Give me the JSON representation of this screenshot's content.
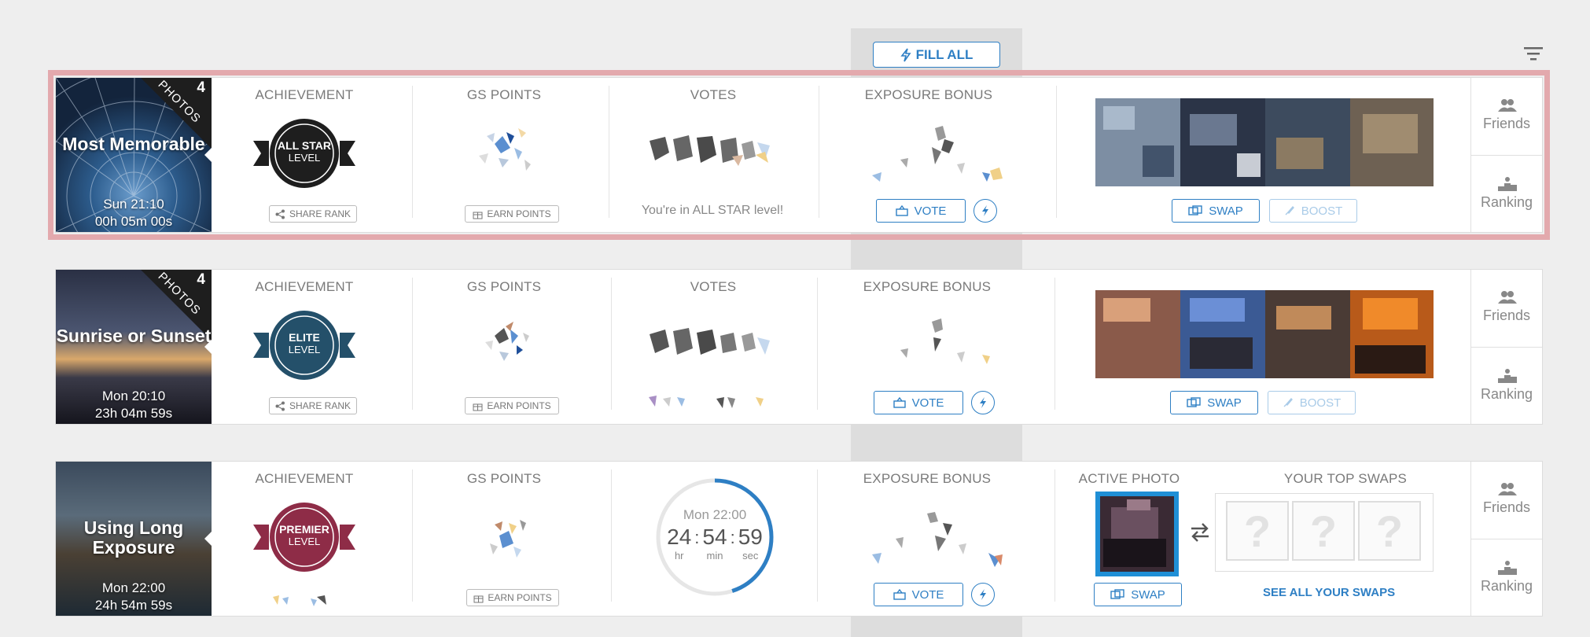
{
  "fill_all_label": "FILL ALL",
  "sections": {
    "achievement": "ACHIEVEMENT",
    "gs_points": "GS POINTS",
    "votes": "VOTES",
    "exposure_bonus": "EXPOSURE BONUS",
    "active_photo": "ACTIVE PHOTO",
    "your_top_swaps": "YOUR TOP SWAPS"
  },
  "buttons": {
    "share_rank": "SHARE RANK",
    "earn_points": "EARN POINTS",
    "vote": "VOTE",
    "swap": "SWAP",
    "boost": "BOOST",
    "see_all_swaps": "SEE ALL YOUR SWAPS"
  },
  "side": {
    "friends": "Friends",
    "ranking": "Ranking"
  },
  "challenges": [
    {
      "photos_label": "PHOTOS",
      "photos_count": "4",
      "title": "Most Memorable",
      "date": "Sun 21:10",
      "countdown": "00h 05m 00s",
      "level_line1": "ALL STAR",
      "level_line2": "LEVEL",
      "level_color": "#1e1e1e",
      "votes_note": "You're in ALL STAR level!"
    },
    {
      "photos_label": "PHOTOS",
      "photos_count": "4",
      "title": "Sunrise or Sunset",
      "date": "Mon 20:10",
      "countdown": "23h 04m 59s",
      "level_line1": "ELITE",
      "level_line2": "LEVEL",
      "level_color": "#24506a"
    },
    {
      "title": "Using Long Exposure",
      "date": "Mon 22:00",
      "countdown": "24h 54m 59s",
      "level_line1": "PREMIER",
      "level_line2": "LEVEL",
      "level_color": "#8e2c47",
      "timer": {
        "date": "Mon 22:00",
        "hours": "24",
        "minutes": "54",
        "seconds": "59",
        "hr": "hr",
        "min": "min",
        "sec": "sec",
        "remaining_fraction": 0.45
      },
      "swap_placeholders": [
        "?",
        "?",
        "?"
      ]
    }
  ]
}
